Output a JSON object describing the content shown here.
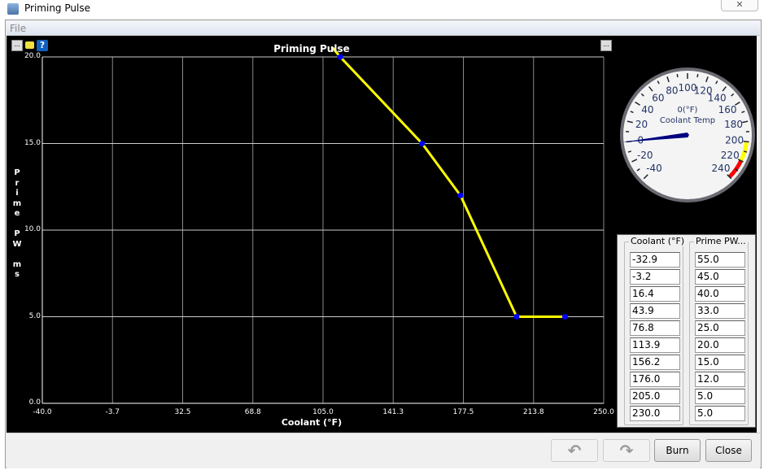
{
  "window": {
    "title": "Priming Pulse",
    "close_glyph": "✕"
  },
  "menu": {
    "file": "File"
  },
  "chart_data": {
    "type": "line",
    "title": "Priming Pulse",
    "xlabel": "Coolant  (°F)",
    "ylabel_letters": [
      "P",
      "r",
      "i",
      "m",
      "e",
      "",
      "P",
      "W",
      "",
      "m",
      "s"
    ],
    "xlim": [
      -40,
      250
    ],
    "ylim": [
      0,
      20
    ],
    "x_ticks": [
      "-40.0",
      "-3.7",
      "32.5",
      "68.8",
      "105.0",
      "141.3",
      "177.5",
      "213.8",
      "250.0"
    ],
    "y_ticks": [
      "0.0",
      "5.0",
      "10.0",
      "15.0",
      "20.0"
    ],
    "grid": true,
    "series": [
      {
        "name": "Prime PW",
        "color": "#ffff00",
        "marker_color": "#0000ff",
        "x": [
          -32.9,
          -3.2,
          16.4,
          43.9,
          76.8,
          113.9,
          156.2,
          176.0,
          205.0,
          230.0
        ],
        "y": [
          55.0,
          45.0,
          40.0,
          33.0,
          25.0,
          20.0,
          15.0,
          12.0,
          5.0,
          5.0
        ]
      }
    ]
  },
  "toolbar": {
    "options_icon": "...",
    "right_options_icon": "...",
    "help": "?"
  },
  "gauge": {
    "title": "Coolant Temp",
    "value_text": "0(°F)",
    "value": 0,
    "min": -40,
    "max": 240,
    "labels": [
      "-40",
      "-20",
      "0",
      "20",
      "40",
      "60",
      "80",
      "100",
      "120",
      "140",
      "160",
      "180",
      "200",
      "220",
      "240"
    ],
    "warn_start": 200,
    "danger_start": 220,
    "warn_color": "#ffff00",
    "danger_color": "#ff0000",
    "needle_color": "#000080"
  },
  "table": {
    "col1_header": "Coolant (°F)",
    "col2_header": "Prime PW...",
    "coolant": [
      "-32.9",
      "-3.2",
      "16.4",
      "43.9",
      "76.8",
      "113.9",
      "156.2",
      "176.0",
      "205.0",
      "230.0"
    ],
    "prime_pw": [
      "55.0",
      "45.0",
      "40.0",
      "33.0",
      "25.0",
      "20.0",
      "15.0",
      "12.0",
      "5.0",
      "5.0"
    ]
  },
  "buttons": {
    "undo": "↶",
    "redo": "↷",
    "burn": "Burn",
    "close": "Close"
  }
}
